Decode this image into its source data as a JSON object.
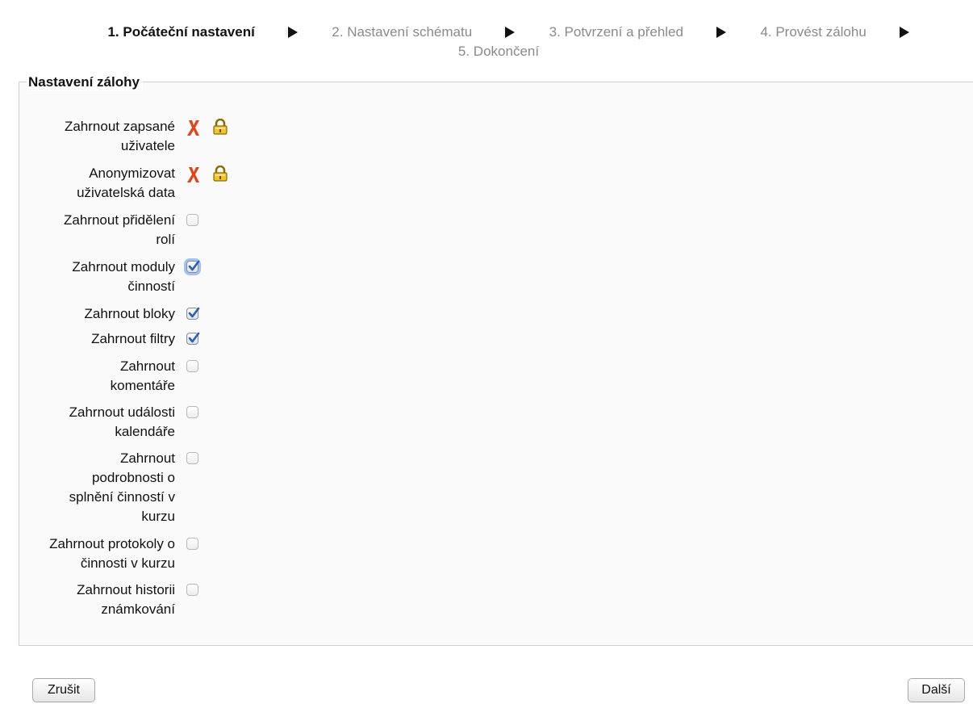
{
  "progress": {
    "steps": [
      {
        "label": "1. Počáteční nastavení",
        "state": "current"
      },
      {
        "label": "2. Nastavení schématu",
        "state": "future"
      },
      {
        "label": "3. Potvrzení a přehled",
        "state": "future"
      },
      {
        "label": "4. Provést zálohu",
        "state": "future"
      },
      {
        "label": "5. Dokončení",
        "state": "future"
      }
    ],
    "separator_icon": "play-arrow-icon"
  },
  "fieldset": {
    "legend": "Nastavení zálohy",
    "settings": [
      {
        "label": "Zahrnout zapsané uživatele",
        "state": "locked-off",
        "icons": [
          "red-x-icon",
          "lock-icon"
        ]
      },
      {
        "label": "Anonymizovat uživatelská data",
        "state": "locked-off",
        "icons": [
          "red-x-icon",
          "lock-icon"
        ]
      },
      {
        "label": "Zahrnout přidělení rolí",
        "state": "unchecked"
      },
      {
        "label": "Zahrnout moduly činností",
        "state": "checked",
        "focused": true
      },
      {
        "label": "Zahrnout bloky",
        "state": "checked"
      },
      {
        "label": "Zahrnout filtry",
        "state": "checked"
      },
      {
        "label": "Zahrnout komentáře",
        "state": "unchecked"
      },
      {
        "label": "Zahrnout události kalendáře",
        "state": "unchecked"
      },
      {
        "label": "Zahrnout podrobnosti o splnění činností v kurzu",
        "state": "unchecked"
      },
      {
        "label": "Zahrnout protokoly o činnosti v kurzu",
        "state": "unchecked"
      },
      {
        "label": "Zahrnout historii známkování",
        "state": "unchecked"
      }
    ]
  },
  "buttons": {
    "cancel": "Zrušit",
    "next": "Další"
  },
  "colors": {
    "current_step": "#111111",
    "future_step": "#8a8a8a",
    "check_blue": "#2a5fb5",
    "x_red": "#e2431c",
    "focus_ring": "#5a96e6"
  }
}
